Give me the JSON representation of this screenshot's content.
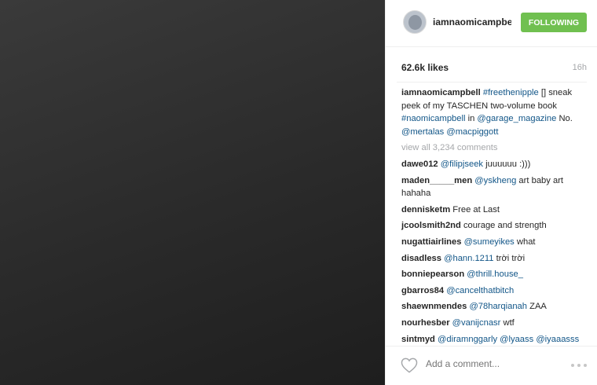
{
  "post": {
    "username": "iamnaomicampbell",
    "follow_label": "FOLLOWING",
    "likes": "62.6k likes",
    "age": "16h"
  },
  "caption": {
    "username": "iamnaomicampbell",
    "hashtag1": "#freethenipple",
    "text1": " [] sneak peek of my TASCHEN two-volume book ",
    "hashtag2": "#naomicampbell",
    "text2": " in ",
    "mention1": "@garage_magazine",
    "text3": " No. ",
    "mention2": "@mertalas",
    "text4": " ",
    "mention3": "@macpiggott"
  },
  "view_all": "view all 3,234 comments",
  "comments": [
    {
      "user": "dawe012",
      "mention": "@filipjseek",
      "text": " juuuuuu :)))"
    },
    {
      "user": "maden_____men",
      "mention": "@yskheng",
      "text": " art baby art hahaha"
    },
    {
      "user": "dennisketm",
      "mention": "",
      "text": "Free at Last"
    },
    {
      "user": "jcoolsmith2nd",
      "mention": "",
      "text": "courage and strength"
    },
    {
      "user": "nugattiairlines",
      "mention": "@sumeyikes",
      "text": " what"
    },
    {
      "user": "disadless",
      "mention": "@hann.1211",
      "text": " trời trời"
    },
    {
      "user": "bonniepearson",
      "mention": "@thrill.house_",
      "text": ""
    },
    {
      "user": "gbarros84",
      "mention": "@cancelthatbitch",
      "text": ""
    },
    {
      "user": "shaewnmendes",
      "mention": "@78harqianah",
      "text": " ZAA"
    },
    {
      "user": "nourhesber",
      "mention": "@vanijcnasr",
      "text": " wtf"
    },
    {
      "user": "sintmyd",
      "mention": "@diramnggarly @lyaass @iyaaasss",
      "text": ""
    }
  ],
  "footer": {
    "add_comment_placeholder": "Add a comment..."
  },
  "icons": {
    "like": "heart-icon",
    "more": "more-options-icon"
  },
  "colors": {
    "follow_green": "#70c050",
    "link_blue": "#125688",
    "muted_gray": "#a5a7aa"
  }
}
